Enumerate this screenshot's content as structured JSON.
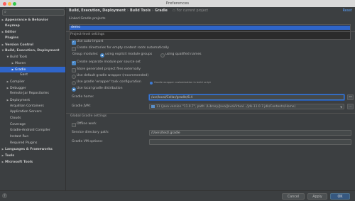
{
  "window": {
    "title": "Preferences"
  },
  "search": {
    "placeholder": ""
  },
  "tree": [
    {
      "label": "Appearance & Behavior",
      "arrow": "▶",
      "indent": 0,
      "bold": true,
      "selected": false
    },
    {
      "label": "Keymap",
      "arrow": "",
      "indent": 0,
      "bold": true,
      "selected": false
    },
    {
      "label": "Editor",
      "arrow": "▶",
      "indent": 0,
      "bold": true,
      "selected": false
    },
    {
      "label": "Plugins",
      "arrow": "",
      "indent": 0,
      "bold": true,
      "selected": false
    },
    {
      "label": "Version Control",
      "arrow": "▶",
      "indent": 0,
      "bold": true,
      "selected": false
    },
    {
      "label": "Build, Execution, Deployment",
      "arrow": "▼",
      "indent": 0,
      "bold": true,
      "selected": false
    },
    {
      "label": "Build Tools",
      "arrow": "▼",
      "indent": 1,
      "bold": false,
      "selected": false
    },
    {
      "label": "Maven",
      "arrow": "▶",
      "indent": 2,
      "bold": false,
      "selected": false
    },
    {
      "label": "Gradle",
      "arrow": "▶",
      "indent": 2,
      "bold": false,
      "selected": true
    },
    {
      "label": "Gant",
      "arrow": "",
      "indent": 3,
      "bold": false,
      "selected": false
    },
    {
      "label": "Compiler",
      "arrow": "▶",
      "indent": 1,
      "bold": false,
      "selected": false
    },
    {
      "label": "Debugger",
      "arrow": "▶",
      "indent": 1,
      "bold": false,
      "selected": false
    },
    {
      "label": "Remote Jar Repositories",
      "arrow": "",
      "indent": 1,
      "bold": false,
      "selected": false
    },
    {
      "label": "Deployment",
      "arrow": "▶",
      "indent": 1,
      "bold": false,
      "selected": false
    },
    {
      "label": "Arquillian Containers",
      "arrow": "",
      "indent": 1,
      "bold": false,
      "selected": false
    },
    {
      "label": "Application Servers",
      "arrow": "",
      "indent": 1,
      "bold": false,
      "selected": false
    },
    {
      "label": "Clouds",
      "arrow": "",
      "indent": 1,
      "bold": false,
      "selected": false
    },
    {
      "label": "Coverage",
      "arrow": "",
      "indent": 1,
      "bold": false,
      "selected": false
    },
    {
      "label": "Gradle-Android Compiler",
      "arrow": "",
      "indent": 1,
      "bold": false,
      "selected": false
    },
    {
      "label": "Instant Run",
      "arrow": "",
      "indent": 1,
      "bold": false,
      "selected": false
    },
    {
      "label": "Required Plugins",
      "arrow": "",
      "indent": 1,
      "bold": false,
      "selected": false
    },
    {
      "label": "Languages & Frameworks",
      "arrow": "▶",
      "indent": 0,
      "bold": true,
      "selected": false
    },
    {
      "label": "Tools",
      "arrow": "▶",
      "indent": 0,
      "bold": true,
      "selected": false
    },
    {
      "label": "Microsoft Tools",
      "arrow": "▶",
      "indent": 0,
      "bold": true,
      "selected": false
    }
  ],
  "header": {
    "crumb1": "Build, Execution, Deployment",
    "crumb2": "Build Tools",
    "crumb3": "Gradle",
    "sep": "›",
    "for_project": "For current project",
    "reset": "Reset"
  },
  "linked": {
    "label": "Linked Gradle projects",
    "project": "demo"
  },
  "project_settings": {
    "title": "Project-level settings",
    "auto_import": "Use auto-import",
    "create_dirs": "Create directories for empty content roots automatically",
    "group_modules_label": "Group modules:",
    "explicit_groups": "using explicit module groups",
    "qualified_names": "using qualified names",
    "separate_module": "Create separate module per source set",
    "store_external": "Store generated project files externally",
    "default_wrapper": "Use default gradle wrapper (recommended)",
    "wrapper_task": "Use gradle 'wrapper' task configuration",
    "wrapper_hint": "Gradle wrapper customization in build script",
    "local_dist": "Use local gradle distribution",
    "gradle_home_label": "Gradle home:",
    "gradle_home_value": "/usr/local/Cellar/gradle/6.4",
    "gradle_jvm_label": "Gradle JVM:",
    "gradle_jvm_value": "11 (java version \"11.0.7\", path: /Library/Java/JavaVirtual.../jdk-11.0.7.jdk/Contents/Home)"
  },
  "global_settings": {
    "title": "Global Gradle settings",
    "offline": "Offline work",
    "service_dir_label": "Service directory path:",
    "service_dir_value": "/Users/test/.gradle",
    "vm_options_label": "Gradle VM options:",
    "vm_options_value": ""
  },
  "footer": {
    "help": "?",
    "cancel": "Cancel",
    "apply": "Apply",
    "ok": "OK"
  },
  "colors": {
    "accent": "#2f65ca",
    "link": "#589df6",
    "primary_button": "#365880"
  }
}
